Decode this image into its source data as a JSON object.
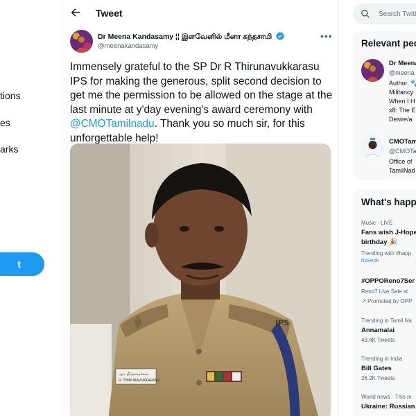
{
  "nav": {
    "items": [
      "tions",
      "es",
      "arks"
    ],
    "tweet_button": "t"
  },
  "header": {
    "title": "Tweet"
  },
  "tweet": {
    "author_name": "Dr Meena Kandasamy ¦¦ இளவேனில் மீனா கந்தசாமி",
    "handle": "@meenakandasamy",
    "text_before": "Immensely grateful to the SP Dr R Thirunavukkarasu IPS for making the generous, split second decision to get me the permission to be allowed on the stage at the last minute at y'day evening's award ceremony with ",
    "mention": "@CMOTamilnadu",
    "text_after": ". Thank you so much sir, for this unforgettable help!",
    "photo": {
      "shoulder_insignia": "IPS",
      "nameplate": [
        "ஆர். திருநாவுக்கரசு",
        "R. THIRUNAVUKKARASU"
      ]
    }
  },
  "search": {
    "placeholder": "Search Twitter"
  },
  "relevant": {
    "title": "Relevant people",
    "people": [
      {
        "name": "Dr Meena",
        "handle": "@meena",
        "bio": [
          "Author. 🐾",
          "Militancy",
          "When I H",
          "x8: The E",
          "Desire/a"
        ]
      },
      {
        "name": "CMOTam",
        "handle": "@CMOTa",
        "bio": [
          "Office of",
          "TamilNad"
        ]
      }
    ]
  },
  "trends": {
    "title": "What's happening",
    "items": [
      {
        "meta": "Music · LIVE",
        "topic": [
          "Fans wish J-Hope",
          "birthday 🎉"
        ],
        "extra": "Trending with #happ",
        "extra2": "hoseok"
      },
      {
        "meta": "",
        "topic": [
          "#OPPOReno7Ser"
        ],
        "extra": "Reno7 Live Sale st",
        "extra2": "Promoted by OPP"
      },
      {
        "meta": "Trending in Tamil Na",
        "topic": [
          "Annamalai"
        ],
        "extra": "43.4K Tweets",
        "extra2": ""
      },
      {
        "meta": "Trending in India",
        "topic": [
          "Bill Gates"
        ],
        "extra": "26.2K Tweets",
        "extra2": ""
      },
      {
        "meta": "World news · This m",
        "topic": [
          "Ukraine: Russian"
        ],
        "extra": "",
        "extra2": ""
      }
    ]
  },
  "colors": {
    "accent": "#1d9bf0",
    "text": "#0f1419",
    "secondary": "#536471"
  }
}
